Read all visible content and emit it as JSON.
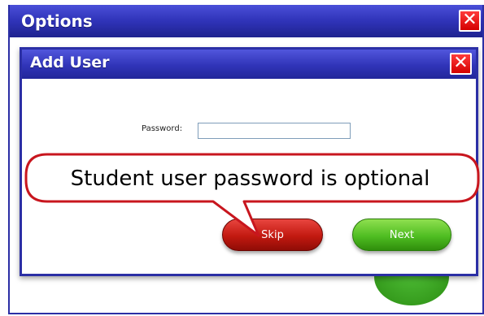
{
  "outer_window": {
    "title": "Options",
    "close_symbol": "✕"
  },
  "dialog": {
    "title": "Add User",
    "close_symbol": "✕",
    "password": {
      "label": "Password:",
      "value": "",
      "placeholder": ""
    },
    "skip_label": "Skip",
    "next_label": "Next"
  },
  "callout": {
    "text": "Student user password is optional"
  },
  "colors": {
    "title_bar": "#2f33b8",
    "close_red": "#e00000",
    "skip_red": "#c21910",
    "next_green": "#4fbd22",
    "callout_border": "#c8161e"
  }
}
